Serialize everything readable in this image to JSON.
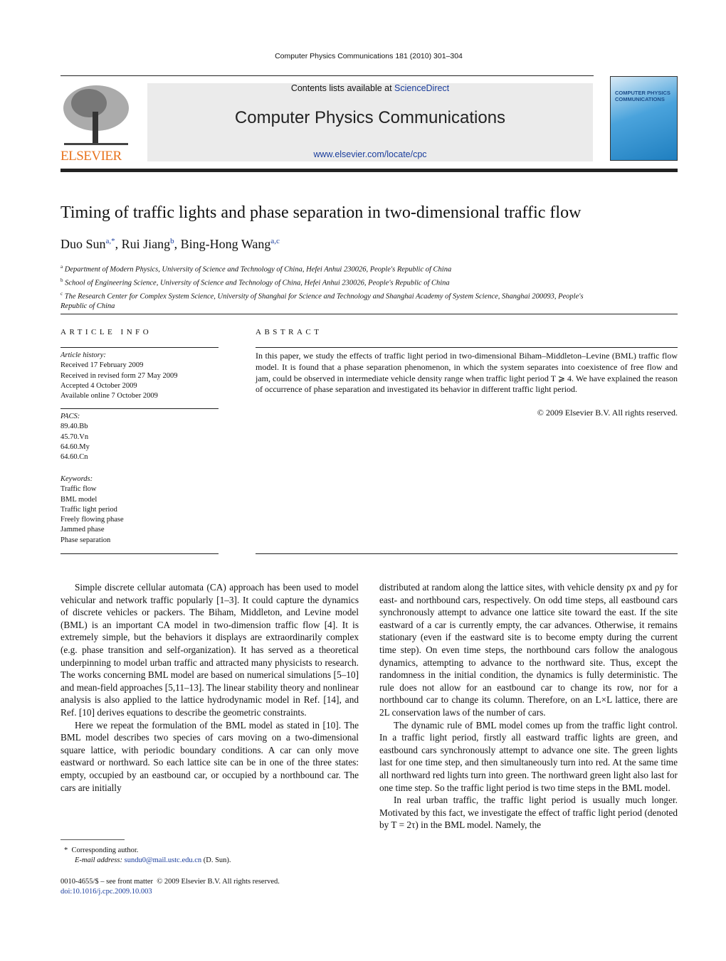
{
  "journal_ref": "Computer Physics Communications 181 (2010) 301–304",
  "masthead": {
    "contents_prefix": "Contents lists available at ",
    "sciencedirect": "ScienceDirect",
    "journal_title": "Computer Physics Communications",
    "url": "www.elsevier.com/locate/cpc",
    "publisher_logo": "ELSEVIER",
    "cover_title": "COMPUTER PHYSICS COMMUNICATIONS",
    "cover_color": "#2c8ec9",
    "publisher_color": "#e8731c"
  },
  "title": "Timing of traffic lights and phase separation in two-dimensional traffic flow",
  "authors": [
    {
      "name": "Duo Sun",
      "sup": "a,*"
    },
    {
      "name": "Rui Jiang",
      "sup": "b"
    },
    {
      "name": "Bing-Hong Wang",
      "sup": "a,c"
    }
  ],
  "affiliations": [
    {
      "sup": "a",
      "text": "Department of Modern Physics, University of Science and Technology of China, Hefei Anhui 230026, People's Republic of China"
    },
    {
      "sup": "b",
      "text": "School of Engineering Science, University of Science and Technology of China, Hefei Anhui 230026, People's Republic of China"
    },
    {
      "sup": "c",
      "text": "The Research Center for Complex System Science, University of Shanghai for Science and Technology and Shanghai Academy of System Science, Shanghai 200093, People's Republic of China"
    }
  ],
  "article_info": {
    "heading": "ARTICLE INFO",
    "history_label": "Article history:",
    "history": [
      "Received 17 February 2009",
      "Received in revised form 27 May 2009",
      "Accepted 4 October 2009",
      "Available online 7 October 2009"
    ],
    "pacs_label": "PACS:",
    "pacs": [
      "89.40.Bb",
      "45.70.Vn",
      "64.60.My",
      "64.60.Cn"
    ],
    "keywords_label": "Keywords:",
    "keywords": [
      "Traffic flow",
      "BML model",
      "Traffic light period",
      "Freely flowing phase",
      "Jammed phase",
      "Phase separation"
    ]
  },
  "abstract": {
    "heading": "ABSTRACT",
    "text": "In this paper, we study the effects of traffic light period in two-dimensional Biham–Middleton–Levine (BML) traffic flow model. It is found that a phase separation phenomenon, in which the system separates into coexistence of free flow and jam, could be observed in intermediate vehicle density range when traffic light period T ⩾ 4. We have explained the reason of occurrence of phase separation and investigated its behavior in different traffic light period.",
    "copyright": "© 2009 Elsevier B.V. All rights reserved."
  },
  "body_left": [
    "Simple discrete cellular automata (CA) approach has been used to model vehicular and network traffic popularly [1–3]. It could capture the dynamics of discrete vehicles or packers. The Biham, Middleton, and Levine model (BML) is an important CA model in two-dimension traffic flow [4]. It is extremely simple, but the behaviors it displays are extraordinarily complex (e.g. phase transition and self-organization). It has served as a theoretical underpinning to model urban traffic and attracted many physicists to research. The works concerning BML model are based on numerical simulations [5–10] and mean-field approaches [5,11–13]. The linear stability theory and nonlinear analysis is also applied to the lattice hydrodynamic model in Ref. [14], and Ref. [10] derives equations to describe the geometric constraints.",
    "Here we repeat the formulation of the BML model as stated in [10]. The BML model describes two species of cars moving on a two-dimensional square lattice, with periodic boundary conditions. A car can only move eastward or northward. So each lattice site can be in one of the three states: empty, occupied by an eastbound car, or occupied by a northbound car. The cars are initially"
  ],
  "body_right": [
    "distributed at random along the lattice sites, with vehicle density ρx and ρy for east- and northbound cars, respectively. On odd time steps, all eastbound cars synchronously attempt to advance one lattice site toward the east. If the site eastward of a car is currently empty, the car advances. Otherwise, it remains stationary (even if the eastward site is to become empty during the current time step). On even time steps, the northbound cars follow the analogous dynamics, attempting to advance to the northward site. Thus, except the randomness in the initial condition, the dynamics is fully deterministic. The rule does not allow for an eastbound car to change its row, nor for a northbound car to change its column. Therefore, on an L×L lattice, there are 2L conservation laws of the number of cars.",
    "The dynamic rule of BML model comes up from the traffic light control. In a traffic light period, firstly all eastward traffic lights are green, and eastbound cars synchronously attempt to advance one site. The green lights last for one time step, and then simultaneously turn into red. At the same time all northward red lights turn into green. The northward green light also last for one time step. So the traffic light period is two time steps in the BML model.",
    "In real urban traffic, the traffic light period is usually much longer. Motivated by this fact, we investigate the effect of traffic light period (denoted by T = 2τ) in the BML model. Namely, the"
  ],
  "footnote": {
    "mark": "*",
    "label": "Corresponding author.",
    "email_label": "E-mail address: ",
    "email": "sundu0@mail.ustc.edu.cn",
    "email_suffix": " (D. Sun)."
  },
  "front_matter": "0010-4655/$ – see front matter  © 2009 Elsevier B.V. All rights reserved.",
  "doi": "doi:10.1016/j.cpc.2009.10.003"
}
